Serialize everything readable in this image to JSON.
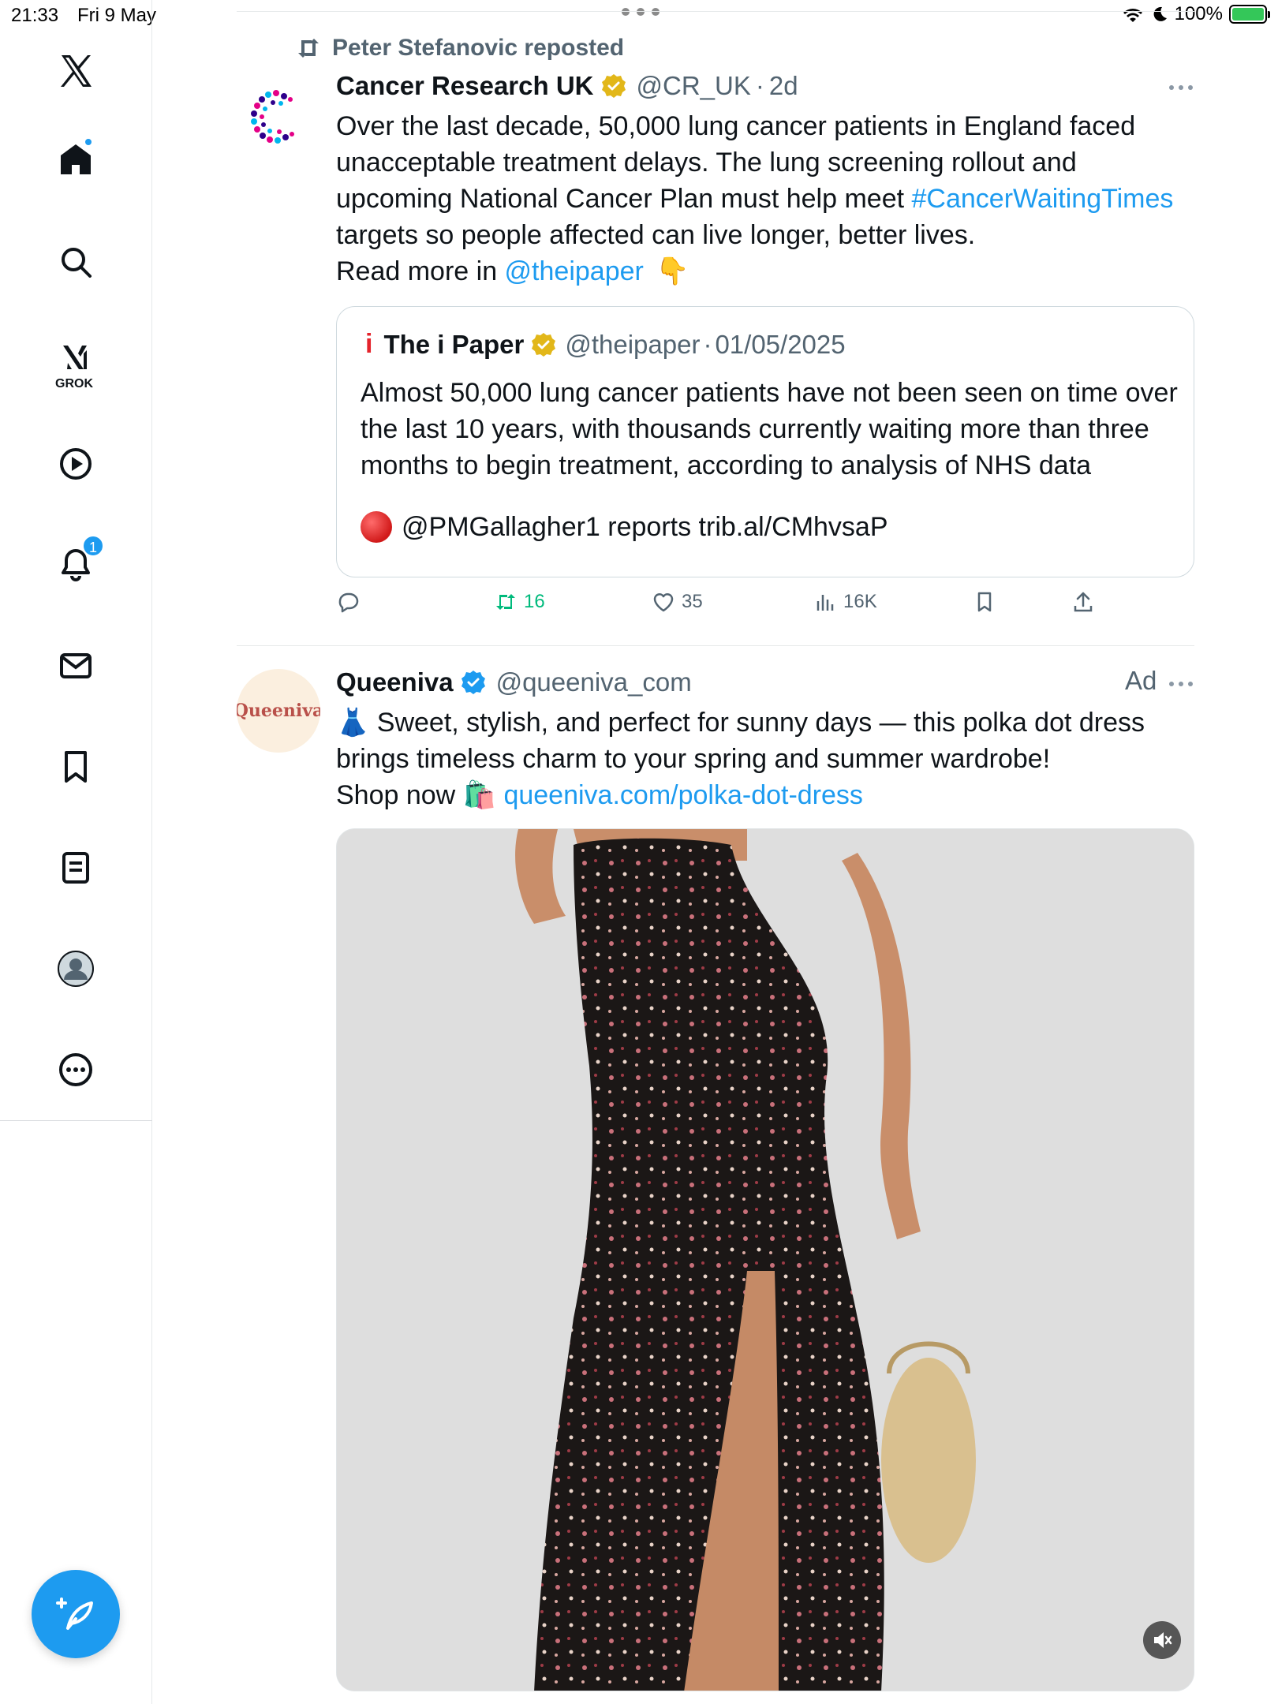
{
  "status_bar": {
    "time": "21:33",
    "date": "Fri 9 May",
    "battery": "100%"
  },
  "sidebar": {
    "grok_label": "GROK",
    "notifications_badge": "1"
  },
  "post1": {
    "repost_label": "Peter Stefanovic reposted",
    "author_name": "Cancer Research UK",
    "author_handle": "@CR_UK",
    "time": "2d",
    "text_1": "Over the last decade, 50,000 lung cancer patients in England faced unacceptable treatment delays. The lung screening rollout and upcoming National Cancer Plan must help meet ",
    "hashtag": "#CancerWaitingTimes",
    "text_2": " targets so people affected can live longer, better lives.",
    "text_3": "Read more in ",
    "mention": "@theipaper",
    "emoji": "👇",
    "quote": {
      "logo_letter": "i",
      "author_name": "The i Paper",
      "author_handle": "@theipaper",
      "date": "01/05/2025",
      "text": "Almost 50,000 lung cancer patients have not been seen on time over the last 10 years, with thousands currently waiting more than three months to begin treatment, according to analysis of NHS data",
      "report": "@PMGallagher1 reports trib.al/CMhvsaP"
    },
    "actions": {
      "reposts": "16",
      "likes": "35",
      "views": "16K"
    }
  },
  "post2": {
    "author_name": "Queeniva",
    "author_handle": "@queeniva_com",
    "avatar_text": "Queeniva",
    "ad_label": "Ad",
    "text_1": "👗 Sweet, stylish, and perfect for sunny days — this polka dot dress brings timeless charm to your spring and summer wardrobe!",
    "text_2": "Shop now 🛍️ ",
    "link": "queeniva.com/polka-dot-dress"
  },
  "colors": {
    "accent": "#1d9bf0",
    "repost_green": "#00ba7c",
    "secondary_text": "#536471",
    "verified_gold": "#e2b719"
  }
}
